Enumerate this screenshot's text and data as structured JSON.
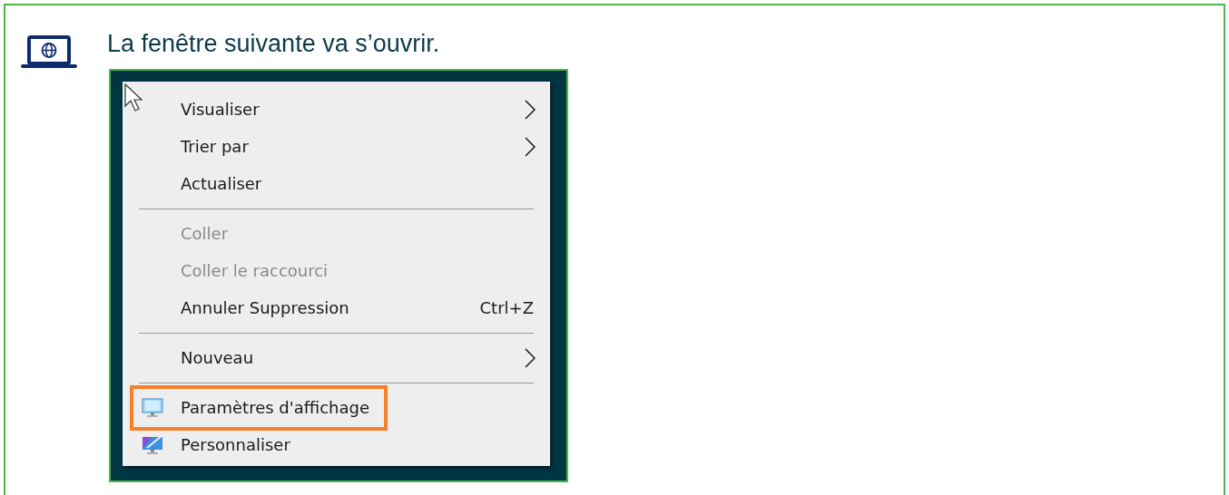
{
  "heading": "La fenêtre suivante va s’ouvrir.",
  "menu": {
    "items": [
      {
        "kind": "item",
        "label": "Visualiser",
        "disabled": false,
        "submenu": true,
        "highlighted": false
      },
      {
        "kind": "item",
        "label": "Trier par",
        "disabled": false,
        "submenu": true,
        "highlighted": false
      },
      {
        "kind": "item",
        "label": "Actualiser",
        "disabled": false,
        "submenu": false,
        "highlighted": false
      },
      {
        "kind": "separator"
      },
      {
        "kind": "item",
        "label": "Coller",
        "disabled": true,
        "submenu": false,
        "highlighted": false
      },
      {
        "kind": "item",
        "label": "Coller le raccourci",
        "disabled": true,
        "submenu": false,
        "highlighted": false
      },
      {
        "kind": "item",
        "label": "Annuler Suppression",
        "shortcut": "Ctrl+Z",
        "disabled": false,
        "submenu": false,
        "highlighted": false
      },
      {
        "kind": "separator"
      },
      {
        "kind": "item",
        "label": "Nouveau",
        "disabled": false,
        "submenu": true,
        "highlighted": false
      },
      {
        "kind": "separator"
      },
      {
        "kind": "display",
        "label": "Paramètres d'affichage",
        "disabled": false,
        "submenu": false,
        "highlighted": true
      },
      {
        "kind": "personalize",
        "label": "Personnaliser",
        "disabled": false,
        "submenu": false,
        "highlighted": false
      }
    ]
  }
}
